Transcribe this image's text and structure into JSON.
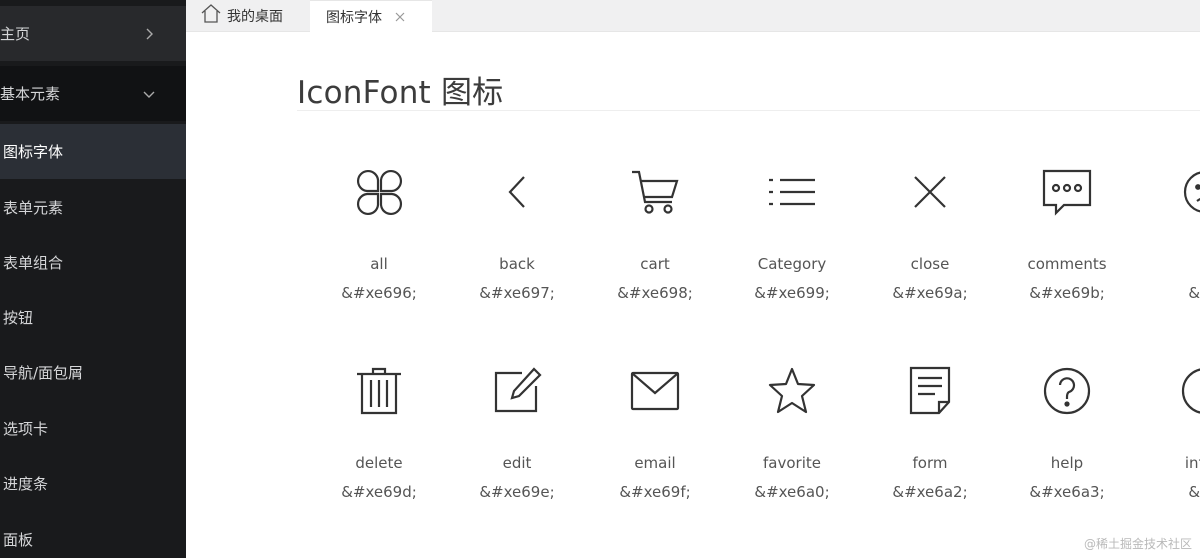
{
  "sidebar": {
    "items": [
      {
        "label": "主页",
        "arrow": "chevron-right-icon"
      },
      {
        "label": "基本元素",
        "arrow": "chevron-down-icon"
      },
      {
        "label": "图标字体"
      },
      {
        "label": "表单元素"
      },
      {
        "label": "表单组合"
      },
      {
        "label": "按钮"
      },
      {
        "label": "导航/面包屑"
      },
      {
        "label": "选项卡"
      },
      {
        "label": "进度条"
      },
      {
        "label": "面板"
      }
    ]
  },
  "tabs": {
    "home_label": "我的桌面",
    "active_label": "图标字体"
  },
  "main": {
    "title": "IconFont 图标"
  },
  "icons": [
    {
      "name": "all",
      "code": "&#xe696;",
      "icon": "all-icon"
    },
    {
      "name": "back",
      "code": "&#xe697;",
      "icon": "back-icon"
    },
    {
      "name": "cart",
      "code": "&#xe698;",
      "icon": "cart-icon"
    },
    {
      "name": "Category",
      "code": "&#xe699;",
      "icon": "category-icon"
    },
    {
      "name": "close",
      "code": "&#xe69a;",
      "icon": "close-icon"
    },
    {
      "name": "comments",
      "code": "&#xe69b;",
      "icon": "comments-icon"
    },
    {
      "name": "c",
      "code": "&#x",
      "icon": "emoji-icon"
    },
    {
      "name": "delete",
      "code": "&#xe69d;",
      "icon": "delete-icon"
    },
    {
      "name": "edit",
      "code": "&#xe69e;",
      "icon": "edit-icon"
    },
    {
      "name": "email",
      "code": "&#xe69f;",
      "icon": "email-icon"
    },
    {
      "name": "favorite",
      "code": "&#xe6a0;",
      "icon": "favorite-icon"
    },
    {
      "name": "form",
      "code": "&#xe6a2;",
      "icon": "form-icon"
    },
    {
      "name": "help",
      "code": "&#xe6a3;",
      "icon": "help-icon"
    },
    {
      "name": "inforr",
      "code": "&#x",
      "icon": "information-icon"
    }
  ],
  "watermark": "@稀土掘金技术社区",
  "colors": {
    "sidebar_bg": "#191a1c",
    "sidebar_active": "#2b2f36",
    "icon_stroke": "#333333",
    "text": "#555555"
  }
}
